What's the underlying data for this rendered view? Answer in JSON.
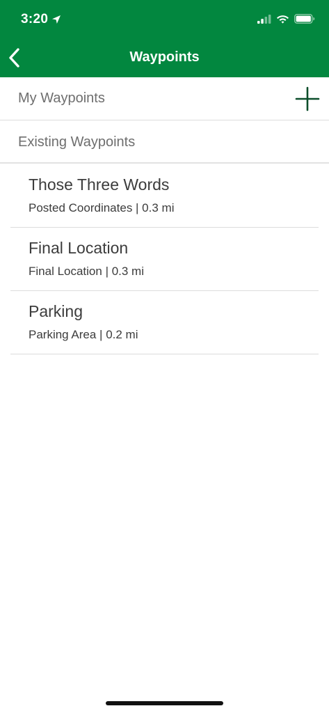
{
  "status_bar": {
    "time": "3:20",
    "location_icon": "location-arrow-icon",
    "signal_icon": "cellular-signal-icon",
    "wifi_icon": "wifi-icon",
    "battery_icon": "battery-icon"
  },
  "nav": {
    "title": "Waypoints",
    "back_icon": "chevron-left-icon"
  },
  "sections": {
    "my_waypoints": "My Waypoints",
    "existing_waypoints": "Existing Waypoints",
    "add_icon": "plus-icon"
  },
  "waypoints": [
    {
      "title": "Those Three Words",
      "subtitle": "Posted Coordinates | 0.3 mi"
    },
    {
      "title": "Final Location",
      "subtitle": "Final Location | 0.3 mi"
    },
    {
      "title": "Parking",
      "subtitle": "Parking Area | 0.2 mi"
    }
  ],
  "colors": {
    "brand_green": "#02873f",
    "add_icon_green": "#0b4d2a",
    "secondary_text": "#6e6e6e",
    "primary_text": "#3c3c3c"
  }
}
